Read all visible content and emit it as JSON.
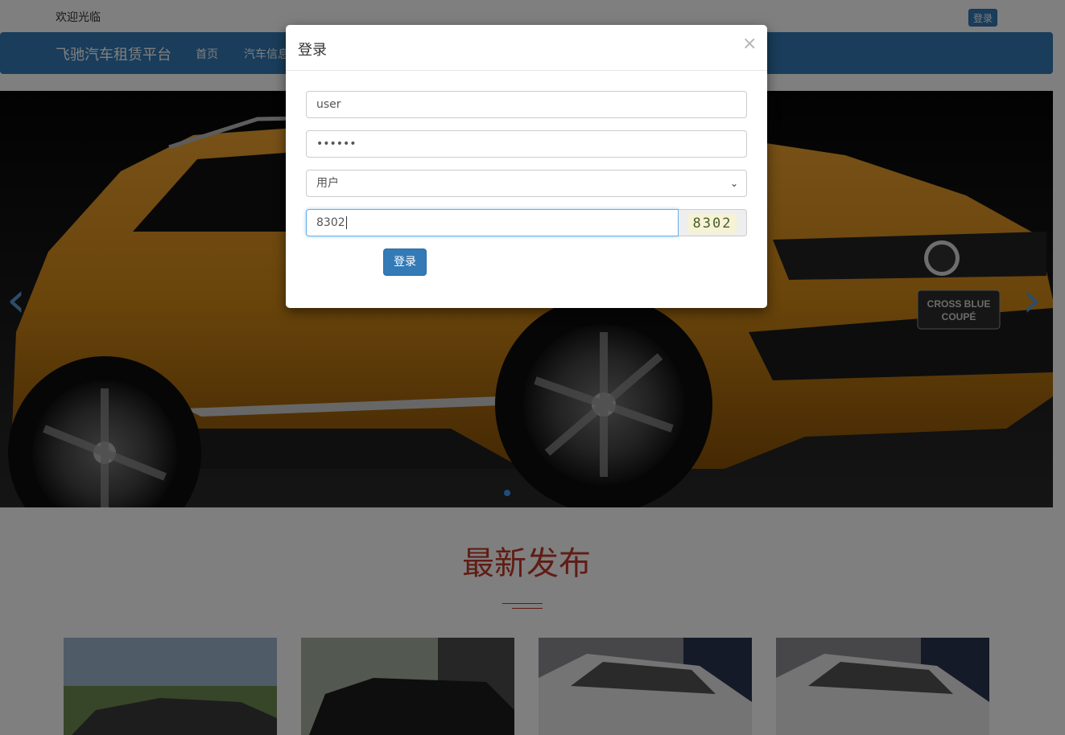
{
  "topbar": {
    "welcome": "欢迎光临",
    "login_label": "登录"
  },
  "navbar": {
    "brand": "飞驰汽车租赁平台",
    "items": [
      {
        "label": "首页"
      },
      {
        "label": "汽车信息"
      }
    ]
  },
  "carousel": {
    "prev_glyph": "‹",
    "next_glyph": "›",
    "plate_line1": "CROSS BLUE",
    "plate_line2": "COUPÉ"
  },
  "section": {
    "title": "最新发布"
  },
  "modal": {
    "title": "登录",
    "close_glyph": "×",
    "username_value": "user",
    "password_value": "123456",
    "role_value": "用户",
    "role_options": [
      "用户"
    ],
    "captcha_value": "8302",
    "captcha_image_text": "8302",
    "submit_label": "登录"
  },
  "colors": {
    "primary": "#337ab7",
    "accent_red": "#c0392b",
    "focus_border": "#66afe9"
  }
}
